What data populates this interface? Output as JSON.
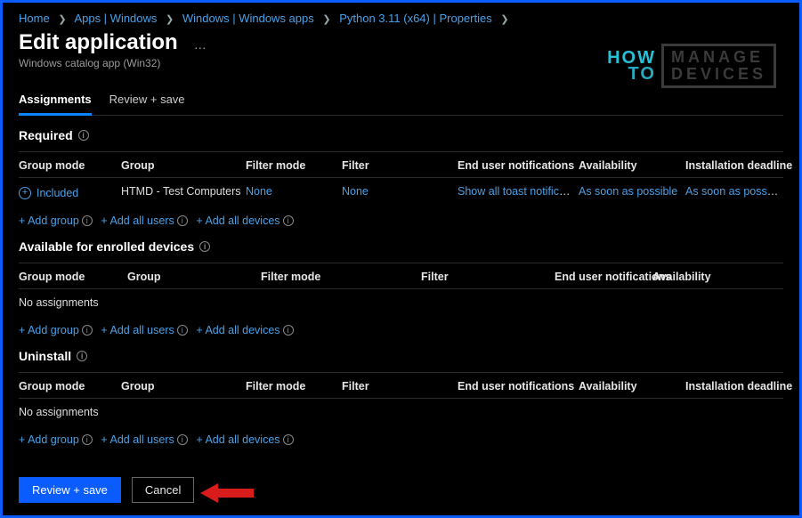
{
  "breadcrumb": [
    {
      "label": "Home"
    },
    {
      "label": "Apps | Windows"
    },
    {
      "label": "Windows | Windows apps"
    },
    {
      "label": "Python 3.11 (x64) | Properties"
    }
  ],
  "page": {
    "title": "Edit application",
    "subtitle": "Windows catalog app (Win32)"
  },
  "watermark": {
    "how": "HOW",
    "to": "TO",
    "manage": "MANAGE",
    "devices": "DEVICES"
  },
  "tabs": [
    {
      "label": "Assignments",
      "active": true
    },
    {
      "label": "Review + save",
      "active": false
    }
  ],
  "sections": {
    "required": {
      "title": "Required",
      "headers": [
        "Group mode",
        "Group",
        "Filter mode",
        "Filter",
        "End user notifications",
        "Availability",
        "Installation deadline"
      ],
      "rows": [
        {
          "group_mode": "Included",
          "group": "HTMD - Test Computers",
          "filter_mode": "None",
          "filter": "None",
          "end_user_notifications": "Show all toast notifications",
          "availability": "As soon as possible",
          "installation_deadline": "As soon as possible"
        }
      ]
    },
    "available": {
      "title": "Available for enrolled devices",
      "headers": [
        "Group mode",
        "Group",
        "Filter mode",
        "Filter",
        "End user notifications",
        "Availability"
      ],
      "empty": "No assignments"
    },
    "uninstall": {
      "title": "Uninstall",
      "headers": [
        "Group mode",
        "Group",
        "Filter mode",
        "Filter",
        "End user notifications",
        "Availability",
        "Installation deadline"
      ],
      "empty": "No assignments"
    }
  },
  "add_links": {
    "add_group": "+ Add group",
    "add_all_users": "+ Add all users",
    "add_all_devices": "+ Add all devices"
  },
  "footer": {
    "primary": "Review + save",
    "secondary": "Cancel"
  }
}
